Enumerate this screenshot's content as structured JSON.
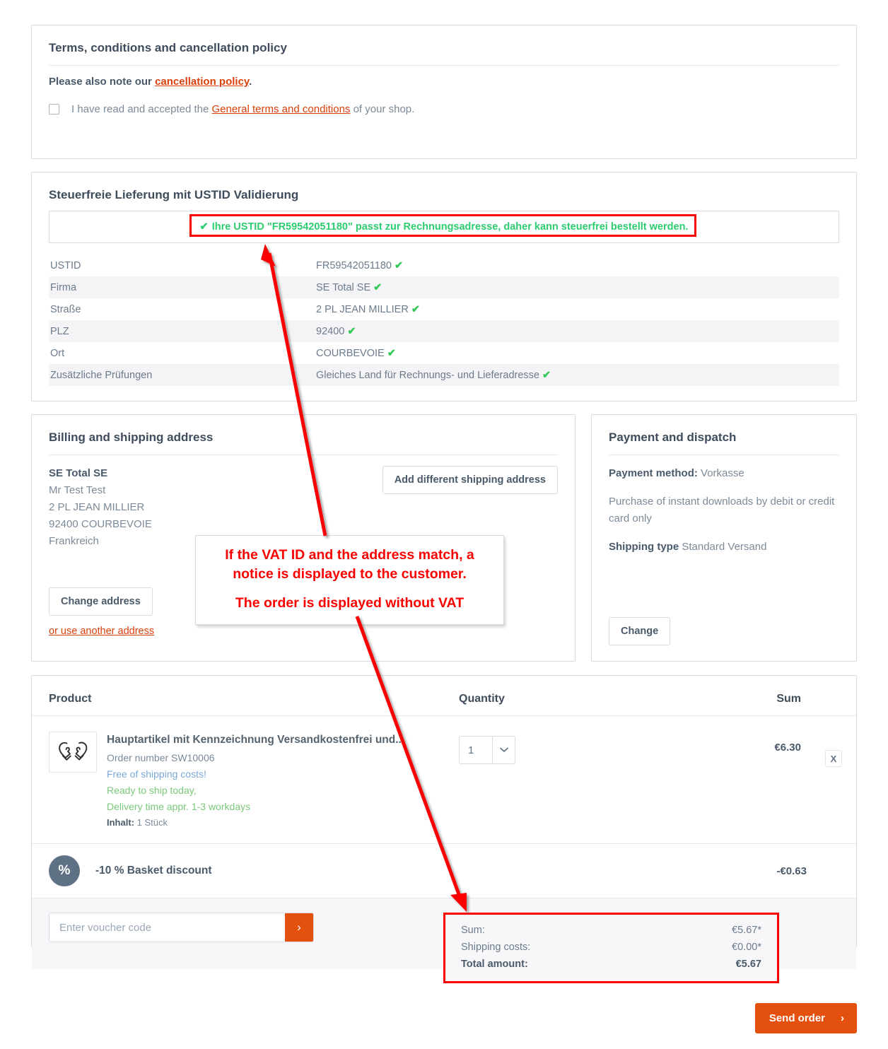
{
  "terms": {
    "title": "Terms, conditions and cancellation policy",
    "note_prefix": "Please also note our ",
    "note_link": "cancellation policy",
    "note_suffix": ".",
    "checkbox_prefix": "I have read and accepted the ",
    "checkbox_link": "General terms and conditions",
    "checkbox_suffix": " of your shop."
  },
  "ustid": {
    "title": "Steuerfreie Lieferung mit USTID Validierung",
    "message_tick": "✔",
    "message": "Ihre USTID \"FR59542051180\" passt zur Rechnungsadresse, daher kann steuerfrei bestellt werden.",
    "rows": [
      {
        "key": "USTID",
        "value": "FR59542051180",
        "tick": "✔"
      },
      {
        "key": "Firma",
        "value": "SE Total SE",
        "tick": "✔"
      },
      {
        "key": "Straße",
        "value": "2 PL JEAN MILLIER",
        "tick": "✔"
      },
      {
        "key": "PLZ",
        "value": "92400",
        "tick": "✔"
      },
      {
        "key": "Ort",
        "value": "COURBEVOIE",
        "tick": "✔"
      },
      {
        "key": "Zusätzliche Prüfungen",
        "value": "Gleiches Land für Rechnungs- und Lieferadresse",
        "tick": "✔"
      }
    ]
  },
  "address": {
    "title": "Billing and shipping address",
    "company": "SE Total SE",
    "line1": "Mr Test Test",
    "line2": "2 PL JEAN MILLIER",
    "line3": "92400 COURBEVOIE",
    "line4": "Frankreich",
    "add_shipping_label": "Add different shipping address",
    "change_label": "Change address",
    "alt_link": "or use another address"
  },
  "payment": {
    "title": "Payment and dispatch",
    "method_label": "Payment method:",
    "method_value": "Vorkasse",
    "method_desc": "Purchase of instant downloads by debit or credit card only",
    "shipping_label": "Shipping type",
    "shipping_value": "Standard Versand",
    "change_label": "Change"
  },
  "cart": {
    "headers": {
      "product": "Product",
      "quantity": "Quantity",
      "sum": "Sum"
    },
    "item": {
      "thumb_icon": "mittens-icon",
      "name": "Hauptartikel mit Kennzeichnung Versandkostenfrei und...",
      "order_number": "Order number SW10006",
      "free_shipping": "Free of shipping costs!",
      "ready": "Ready to ship today,",
      "delivery": "Delivery time appr. 1-3 workdays",
      "content_label": "Inhalt:",
      "content_value": "1 Stück",
      "quantity": "1",
      "sum": "€6.30",
      "remove_label": "X"
    },
    "discount": {
      "badge": "%",
      "label": "-10 % Basket discount",
      "sum": "-€0.63"
    },
    "voucher_placeholder": "Enter voucher code",
    "voucher_submit": "›"
  },
  "totals": {
    "rows": [
      {
        "label": "Sum:",
        "value": "€5.67*",
        "strong": false
      },
      {
        "label": "Shipping costs:",
        "value": "€0.00*",
        "strong": false
      },
      {
        "label": "Total amount:",
        "value": "€5.67",
        "strong": true
      }
    ]
  },
  "send_order": {
    "label": "Send order",
    "chevron": "›"
  },
  "annotation": {
    "line1": "If the VAT ID and the address match, a",
    "line2": "notice is displayed to the customer.",
    "line3": "The order is displayed without VAT"
  },
  "colors": {
    "accent_orange": "#e4510e",
    "link_orange": "#d9400b",
    "success_green": "#2ecc71",
    "annotation_red": "#fa0000",
    "text_dark": "#3f4c5c",
    "text_muted": "#7b8a99"
  }
}
